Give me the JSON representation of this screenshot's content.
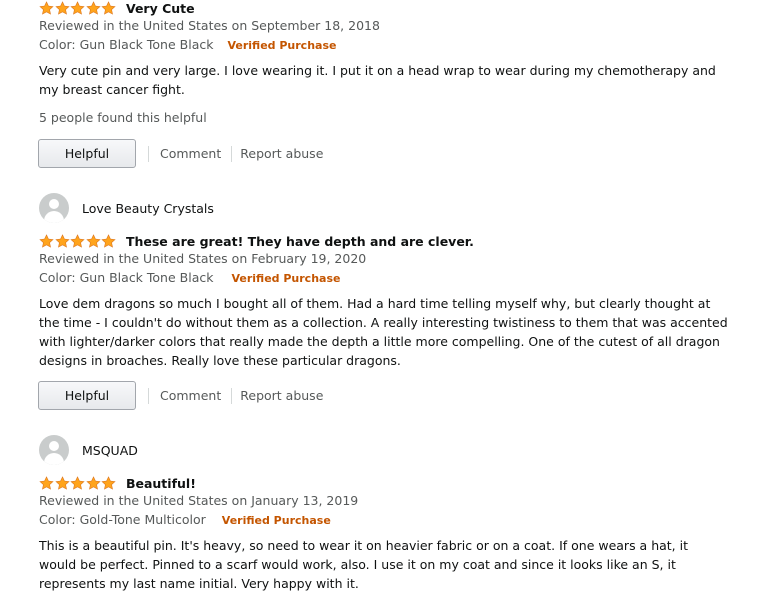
{
  "colors": {
    "star": "#ffa41c",
    "verified": "#c45500",
    "muted": "#565959"
  },
  "reviews": [
    {
      "profile_name": "",
      "rating": 5,
      "title": "Very Cute",
      "date": "Reviewed in the United States on September 18, 2018",
      "variant": "Color: Gun Black Tone Black",
      "verified": "Verified Purchase",
      "body": "Very cute pin and very large. I love wearing it. I put it on a head wrap to wear during my chemotherapy and my breast cancer fight.",
      "found_helpful": "5 people found this helpful",
      "helpful_label": "Helpful",
      "comment_label": "Comment",
      "report_label": "Report abuse"
    },
    {
      "profile_name": "Love Beauty Crystals",
      "rating": 5,
      "title": "These are great! They have depth and are clever.",
      "date": "Reviewed in the United States on February 19, 2020",
      "variant": "Color: Gun Black Tone Black",
      "verified": "Verified Purchase",
      "body": "Love dem dragons so much I bought all of them. Had a hard time telling myself why, but clearly thought at the time - I couldn't do without them as a collection. A really interesting twistiness to them that was accented with lighter/darker colors that really made the depth a little more compelling. One of the cutest of all dragon designs in broaches. Really love these particular dragons.",
      "helpful_label": "Helpful",
      "comment_label": "Comment",
      "report_label": "Report abuse"
    },
    {
      "profile_name": "MSQUAD",
      "rating": 5,
      "title": "Beautiful!",
      "date": "Reviewed in the United States on January 13, 2019",
      "variant": "Color: Gold-Tone Multicolor",
      "verified": "Verified Purchase",
      "body": "This is a beautiful pin. It's heavy, so need to wear it on heavier fabric or on a coat. If one wears a hat, it would be perfect. Pinned to a scarf would work, also. I use it on my coat and since it looks like an S, it represents my last name initial. Very happy with it."
    }
  ]
}
